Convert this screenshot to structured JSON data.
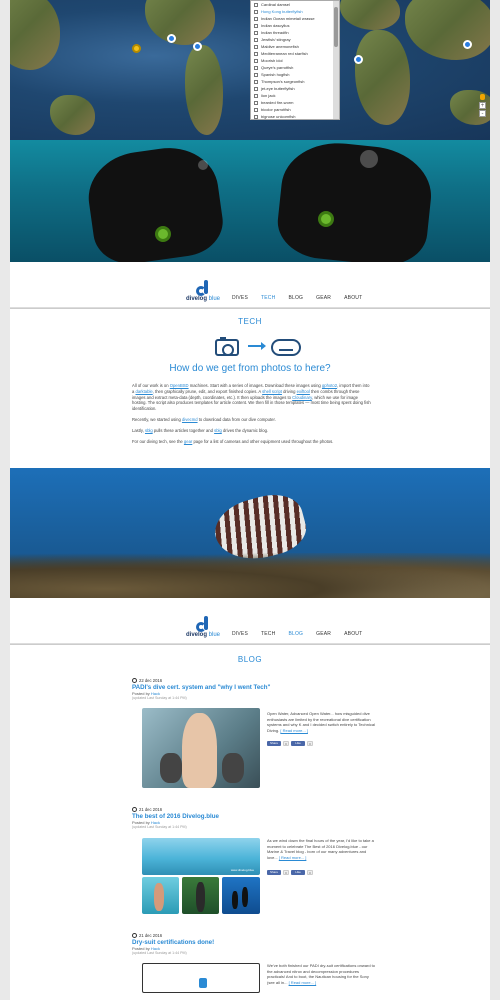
{
  "map": {
    "list_items": [
      "Cardinal damsel",
      "Hong Kong butterflyfish",
      "Indian Ocean mimetail wrasse",
      "Indian dascyllus",
      "Indian threadfin",
      "Jewfish/ stingray",
      "Maldive anemonefish",
      "Mediterranean red starfish",
      "Moorish idol",
      "Queye's parrotfish",
      "Spanish hogfish",
      "Thompson's surgeonfish",
      "jet-eye butterflyfish",
      "lion jack",
      "bearded fire-worm",
      "bicolor parrotfish",
      "bignose unicornfish"
    ],
    "active_index": 1,
    "zoom_in": "+",
    "zoom_out": "-"
  },
  "nav": {
    "logo_main": "divelog",
    "logo_sub": "blue",
    "links": [
      "DIVES",
      "TECH",
      "BLOG",
      "GEAR",
      "ABOUT"
    ]
  },
  "nav2": {
    "links": [
      "DIVES",
      "TECH",
      "BLOG",
      "GEAR",
      "ABOUT"
    ]
  },
  "tech": {
    "title": "TECH",
    "heading": "How do we get from photos to here?",
    "p1_a": "All of our work is on ",
    "p1_link1": "OpenBSD",
    "p1_b": " machines. Start with a series of images. Download these images using ",
    "p1_link2": "gphoto2",
    "p1_c": ", import them into a ",
    "p1_link3": "darktable",
    "p1_d": ", then graphically prune, edit, and export finished copies. A ",
    "p1_link4": "shell script",
    "p1_e": " driving ",
    "p1_link5": "exiftool",
    "p1_f": " then combs through these images and extract meta-data (depth, coordinates, etc.). It then uploads the images to ",
    "p1_link6": "Cloudinary",
    "p1_g": ", which we use for image hosting. The script also produces templates for article content. We then fill in those templates — most time being spent doing fish identification.",
    "p2_a": "Recently, we started using ",
    "p2_link": "divecmd",
    "p2_b": " to download data from our dive computer.",
    "p3_a": "Lastly, ",
    "p3_link1": "sblg",
    "p3_b": " pulls these articles together and ",
    "p3_link2": "sblg",
    "p3_c": " drives the dynamic blog.",
    "p4_a": "For our diving tech, see the ",
    "p4_link": "gear",
    "p4_b": " page for a list of cameras and other equipment used throughout the photos."
  },
  "blog": {
    "title": "BLOG",
    "posts": [
      {
        "date": "22 dec 2016",
        "title": "PADI's dive cert. system and \"why I went Tech\"",
        "posted_by": "Posted by",
        "author": "Hack",
        "updated": "(updated Last Sunday at 1:44 PM)",
        "excerpt": "Open Water, Advanced Open Water... how misguided dive enthusiasts are limited by the recreational dive certification systems and why K and I decided switch entirely to Technical Diving.",
        "more": "[ Read more... ]"
      },
      {
        "date": "21 dec 2016",
        "title": "The best of 2016 Divelog.blue",
        "posted_by": "Posted by",
        "author": "Hack",
        "updated": "(updated Last Sunday at 1:44 PM)",
        "excerpt": "As we wind down the final hours of the year, I'd like to take a moment to celebrate The Best of 2016 Divelog.blue - our Marine & Travel blog - born of our many adventures and love...",
        "more": "[ Read more... ]",
        "image_caption": "www.divelog.blue"
      },
      {
        "date": "21 dec 2016",
        "title": "Dry-suit certifications done!",
        "posted_by": "Posted by",
        "author": "Hack",
        "updated": "(updated Last Sunday at 1:44 PM)",
        "excerpt": "We've both finished our PADI dry-suit certifications onward to the advanced nitrox and decompression procedures practicals! And to boot, the Nautican housing for the Sony (see all in...",
        "more": "[ Read more... ]"
      }
    ],
    "share": {
      "fb": "Share",
      "like": "Like",
      "count": "0"
    }
  }
}
